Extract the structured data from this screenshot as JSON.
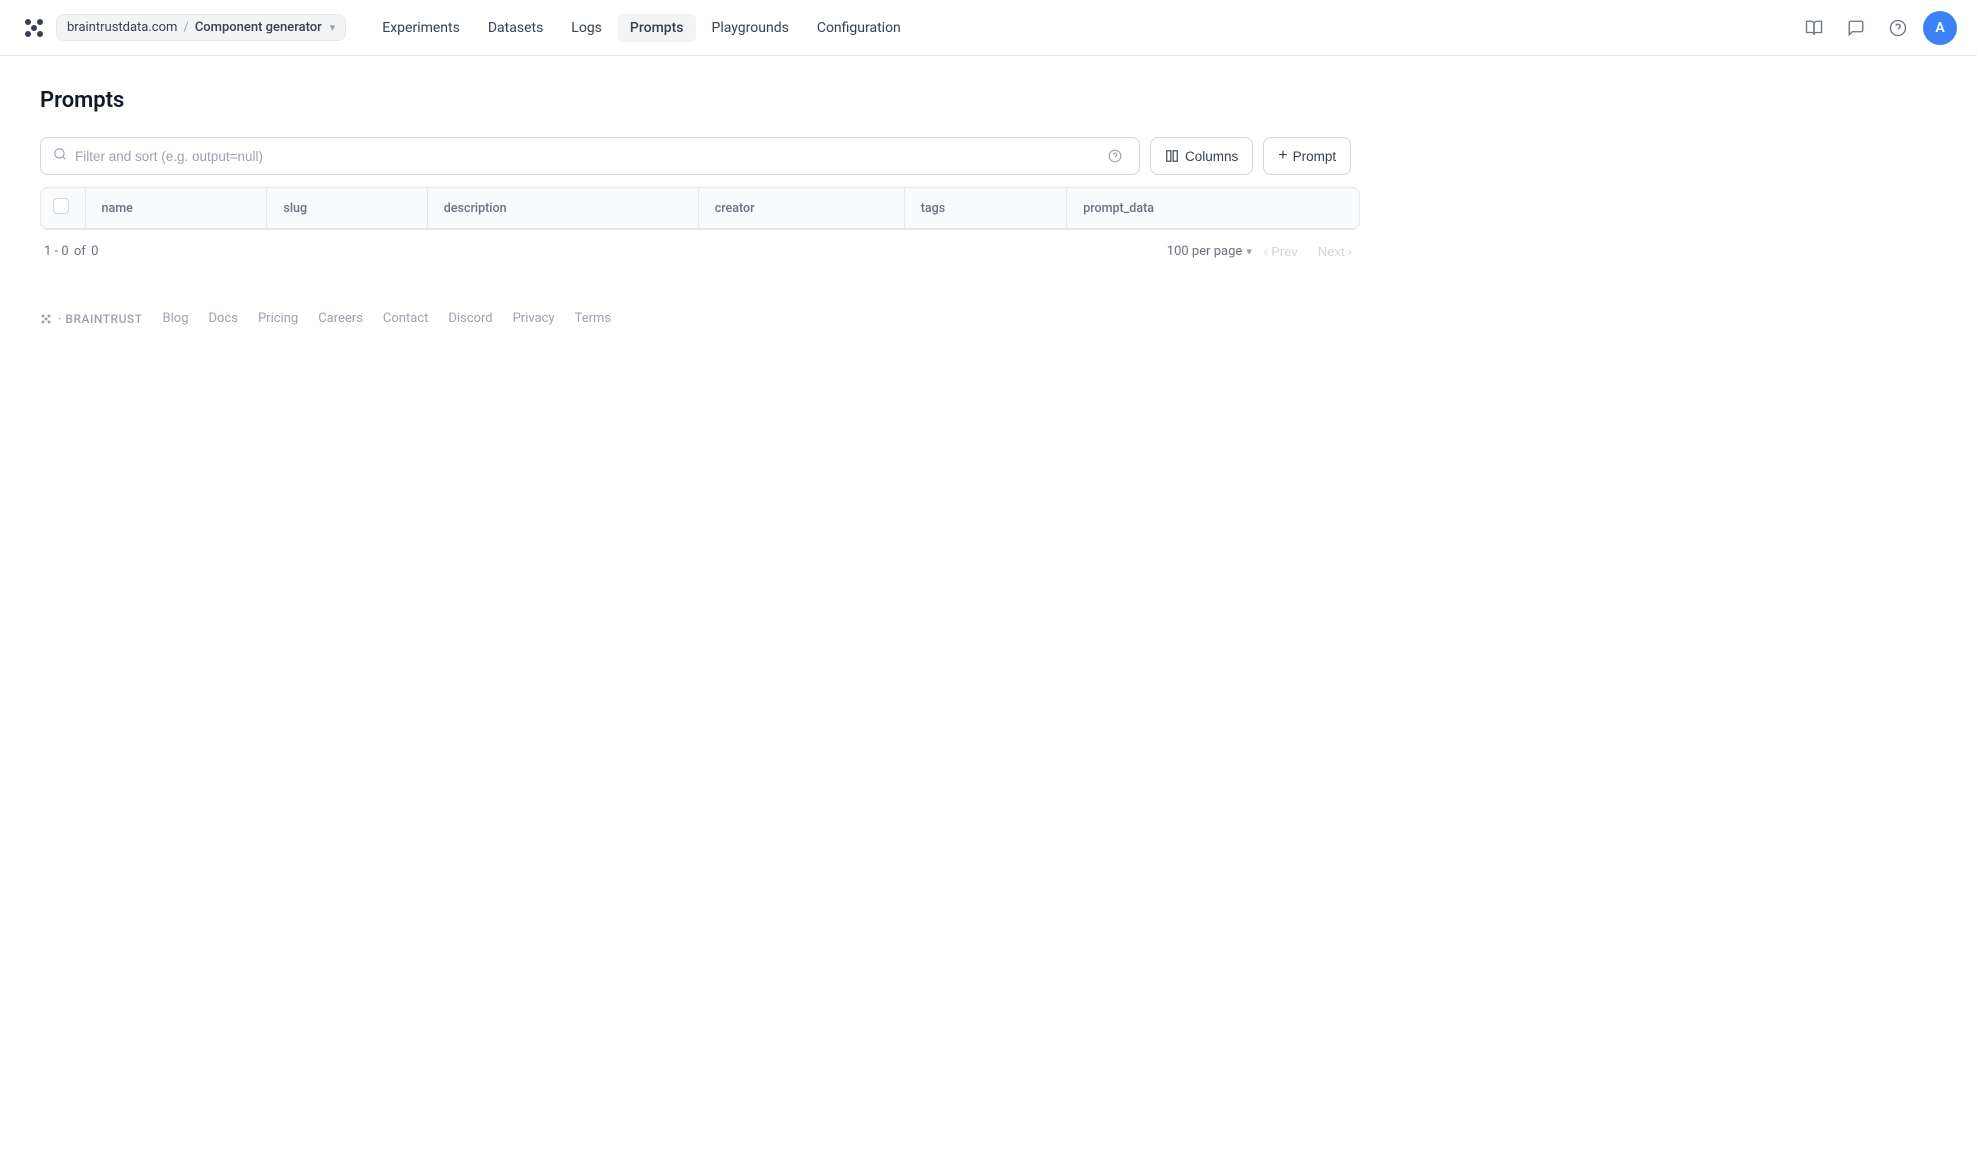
{
  "navbar": {
    "logo_alt": "Braintrust logo",
    "breadcrumb": {
      "org": "braintrustdata.com",
      "separator": "/",
      "project": "Component generator"
    },
    "nav_items": [
      {
        "id": "experiments",
        "label": "Experiments",
        "active": false
      },
      {
        "id": "datasets",
        "label": "Datasets",
        "active": false
      },
      {
        "id": "logs",
        "label": "Logs",
        "active": false
      },
      {
        "id": "prompts",
        "label": "Prompts",
        "active": true
      },
      {
        "id": "playgrounds",
        "label": "Playgrounds",
        "active": false
      },
      {
        "id": "configuration",
        "label": "Configuration",
        "active": false
      }
    ],
    "avatar_letter": "A"
  },
  "page": {
    "title": "Prompts"
  },
  "toolbar": {
    "search_placeholder": "Filter and sort (e.g. output=null)",
    "columns_label": "Columns",
    "add_prompt_label": "Prompt",
    "add_prompt_icon": "+"
  },
  "table": {
    "columns": [
      {
        "id": "name",
        "label": "name"
      },
      {
        "id": "slug",
        "label": "slug"
      },
      {
        "id": "description",
        "label": "description"
      },
      {
        "id": "creator",
        "label": "creator"
      },
      {
        "id": "tags",
        "label": "tags"
      },
      {
        "id": "prompt_data",
        "label": "prompt_data"
      }
    ],
    "rows": []
  },
  "pagination": {
    "range": "1 - 0",
    "of_label": "of",
    "total": "0",
    "per_page": "100 per page",
    "prev_label": "Prev",
    "next_label": "Next"
  },
  "footer": {
    "brand": "· BRAINTRUST",
    "links": [
      {
        "id": "blog",
        "label": "Blog"
      },
      {
        "id": "docs",
        "label": "Docs"
      },
      {
        "id": "pricing",
        "label": "Pricing"
      },
      {
        "id": "careers",
        "label": "Careers"
      },
      {
        "id": "contact",
        "label": "Contact"
      },
      {
        "id": "discord",
        "label": "Discord"
      },
      {
        "id": "privacy",
        "label": "Privacy"
      },
      {
        "id": "terms",
        "label": "Terms"
      }
    ]
  }
}
